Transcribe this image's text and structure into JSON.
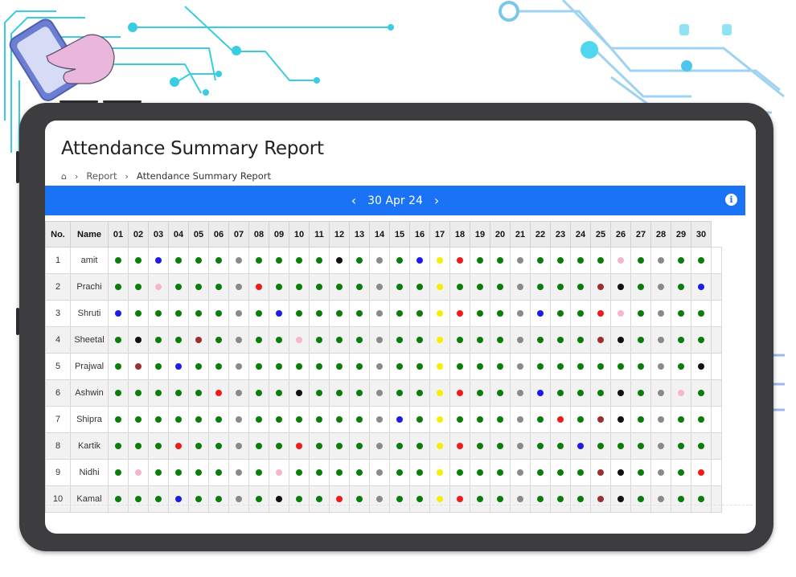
{
  "report": {
    "title": "Attendance Summary Report",
    "breadcrumb": [
      "Report",
      "Attendance Summary Report"
    ],
    "date_label": "30 Apr 24"
  },
  "colors": {
    "brand_bar": "#1a73f4",
    "status": {
      "G": "#0a7d0a",
      "B": "#1c1ce8",
      "K": "#111111",
      "R": "#ee1b1b",
      "Y": "#f5f000",
      "P": "#f5b8c8",
      "S": "#8a8a8a",
      "M": "#9b3030"
    }
  },
  "icons": {
    "home": "home-icon",
    "prev": "chevron-left-icon",
    "next": "chevron-right-icon",
    "info": "info-icon"
  },
  "table": {
    "headers": [
      "No.",
      "Name",
      "01",
      "02",
      "03",
      "04",
      "05",
      "06",
      "07",
      "08",
      "09",
      "10",
      "11",
      "12",
      "13",
      "14",
      "15",
      "16",
      "17",
      "18",
      "19",
      "20",
      "21",
      "22",
      "23",
      "24",
      "25",
      "26",
      "27",
      "28",
      "29",
      "30"
    ],
    "rows": [
      {
        "no": "1",
        "name": "amit",
        "status": "GGBGGGSGGGGKGSGBYRGGSGGGGPGSGG"
      },
      {
        "no": "2",
        "name": "Prachi",
        "status": "GGPGGGSRGGGGGSGGYGGGSGGGMKGSGB"
      },
      {
        "no": "3",
        "name": "Shruti",
        "status": "BGGGGGSGBGGGGSGGYRGGSBGGRPGSGG"
      },
      {
        "no": "4",
        "name": "Sheetal",
        "status": "GKGGMGSGGPGGGSGGYGGGSGGGMKGSGG"
      },
      {
        "no": "5",
        "name": "Prajwal",
        "status": "GMGBGGSGGGGGGSGGYGGGSGGGGGGSGK"
      },
      {
        "no": "6",
        "name": "Ashwin",
        "status": "GGGGGRSGGKGGGSGGYRGGSBGGGKGSPG"
      },
      {
        "no": "7",
        "name": "Shipra",
        "status": "GGGGGGSGGGGGGSBGYGGGSGRGMKGSGG"
      },
      {
        "no": "8",
        "name": "Kartik",
        "status": "GGGRGGSGGRGGGSGGYRGGSGGBGGGSGG"
      },
      {
        "no": "9",
        "name": "Nidhi",
        "status": "GPGGGGSGPGGGGSGGYGGGSGGGMKGSGR"
      },
      {
        "no": "10",
        "name": "Kamal",
        "status": "GGGBGGSGKGGRGSGGYRGGSGGGMKGSGG"
      }
    ]
  }
}
